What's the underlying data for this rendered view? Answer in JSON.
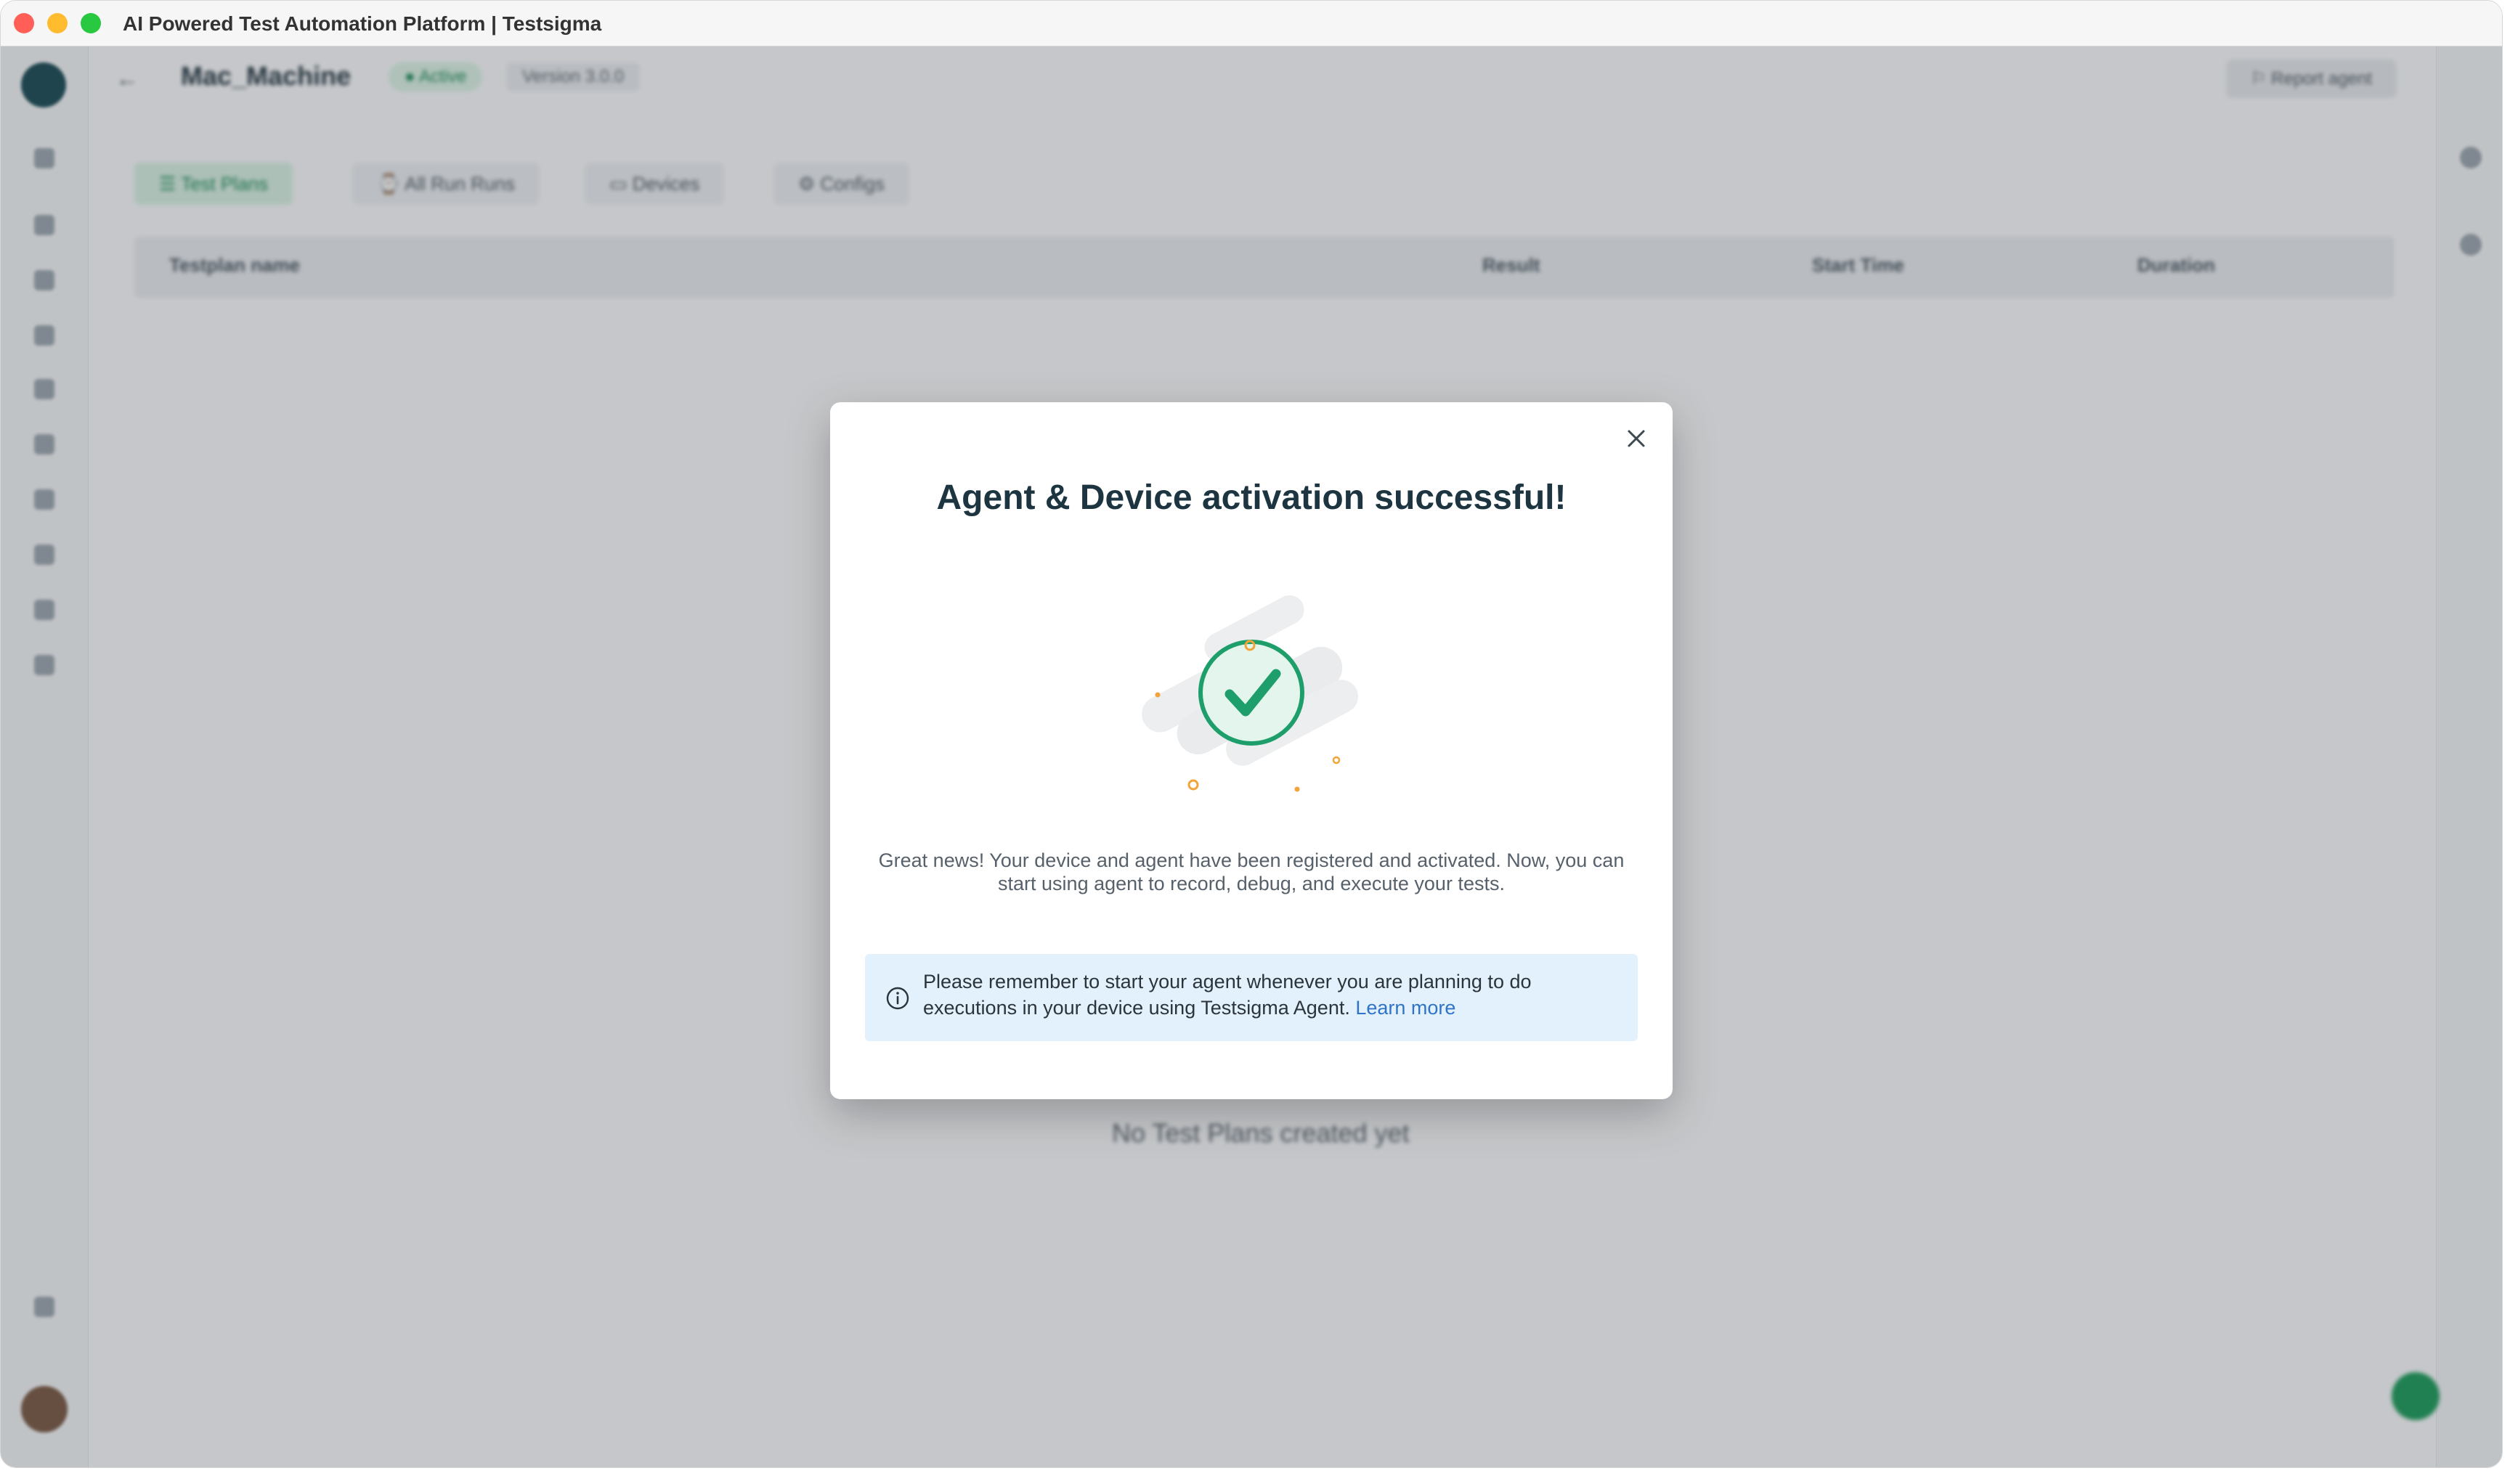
{
  "window": {
    "title": "AI Powered Test Automation Platform | Testsigma"
  },
  "header": {
    "agent_name": "Mac_Machine",
    "status": "● Active",
    "version": "Version 3.0.0",
    "report_button": "⚐ Report agent"
  },
  "tabs": [
    {
      "label": "☰ Test Plans"
    },
    {
      "label": "⌚ All Run Runs"
    },
    {
      "label": "▭ Devices"
    },
    {
      "label": "⚙ Configs"
    }
  ],
  "table": {
    "columns": [
      "Testplan name",
      "Result",
      "Start Time",
      "Duration"
    ]
  },
  "empty_state": "No Test Plans created yet",
  "modal": {
    "title": "Agent & Device activation successful!",
    "description": "Great news! Your device and agent have been registered and activated. Now, you can start using agent to record, debug, and execute your tests.",
    "info_text": "Please remember to start your agent whenever you are planning to do executions in your device using Testsigma Agent.",
    "learn_more": "Learn more",
    "colors": {
      "success": "#1e9e6a",
      "accent_dots": "#f2a33a",
      "info_bg": "#e3f1fd",
      "link": "#2f74c6"
    }
  }
}
